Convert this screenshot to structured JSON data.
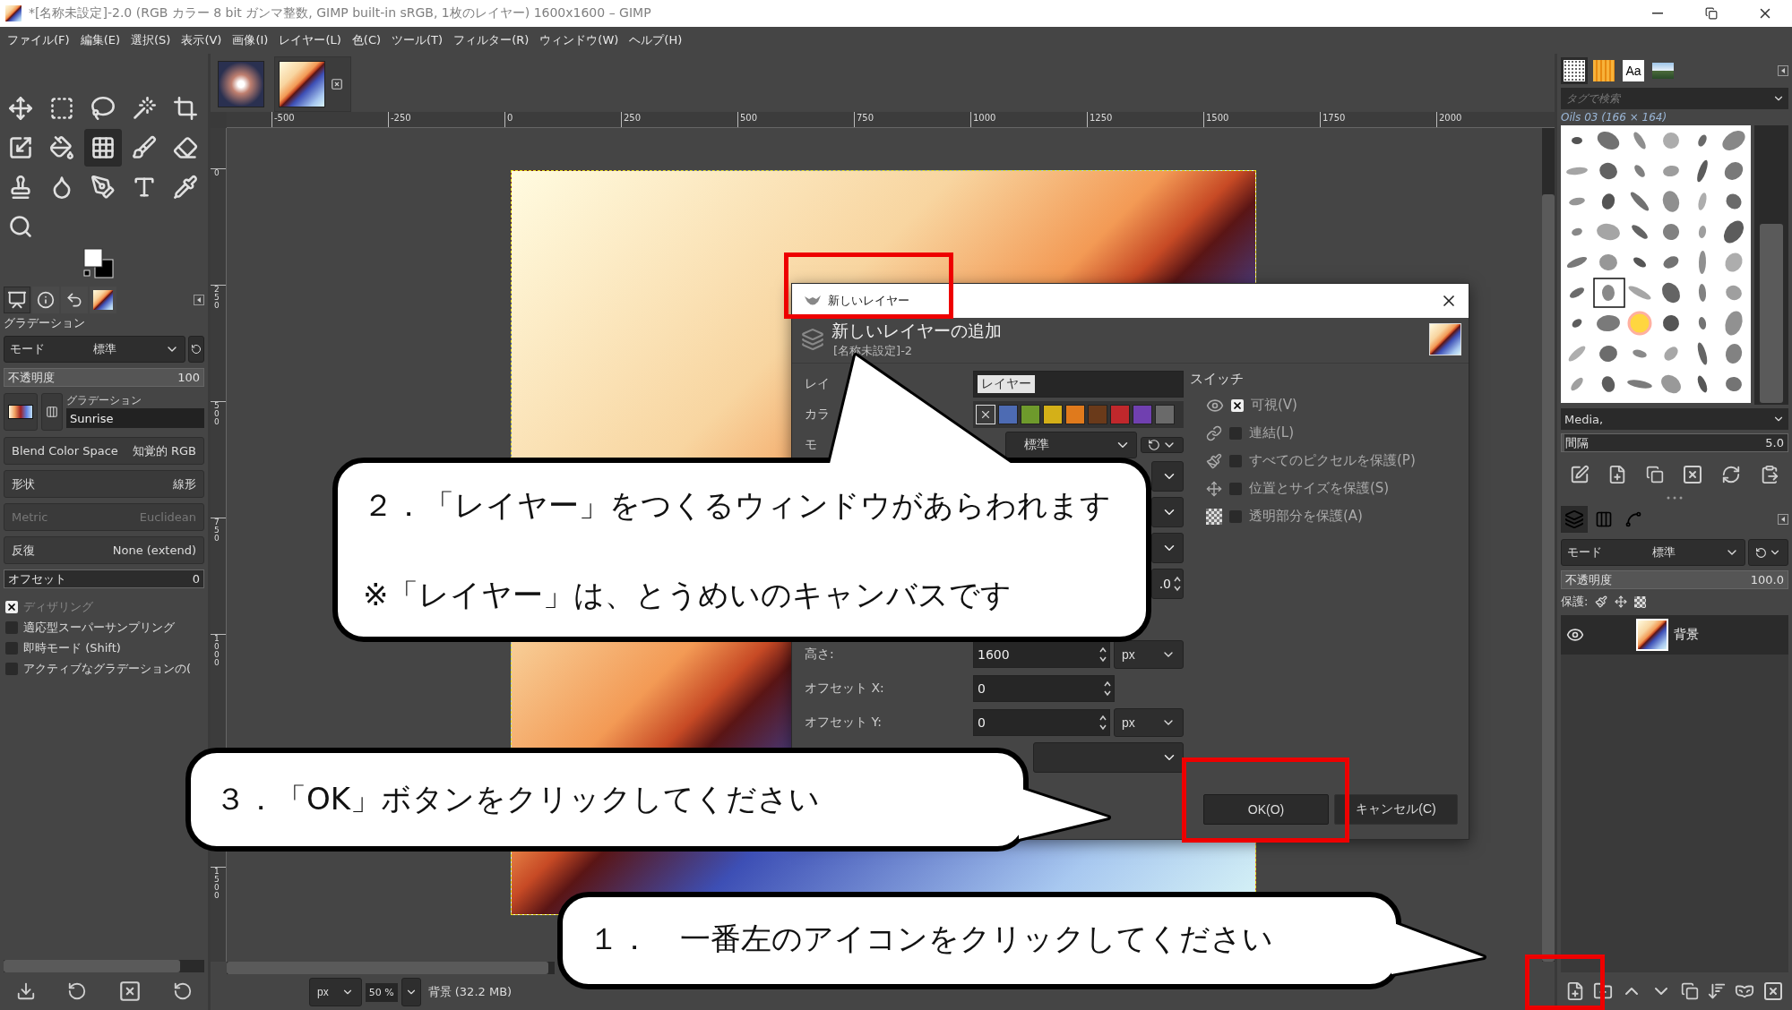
{
  "window": {
    "title": "*[名称未設定]-2.0 (RGB カラー 8 bit ガンマ整数, GIMP built-in sRGB, 1枚のレイヤー) 1600x1600 – GIMP"
  },
  "menu": [
    "ファイル(F)",
    "編集(E)",
    "選択(S)",
    "表示(V)",
    "画像(I)",
    "レイヤー(L)",
    "色(C)",
    "ツール(T)",
    "フィルター(R)",
    "ウィンドウ(W)",
    "ヘルプ(H)"
  ],
  "toolbox": {
    "tools": [
      {
        "selected": false
      },
      {
        "selected": false
      },
      {
        "selected": false
      },
      {
        "selected": false
      },
      {
        "selected": false
      },
      {
        "selected": false
      },
      {
        "selected": false
      },
      {
        "selected": true
      },
      {
        "selected": false
      },
      {
        "selected": false
      },
      {
        "selected": false
      },
      {
        "selected": false
      },
      {
        "selected": false
      },
      {
        "selected": false
      },
      {
        "selected": false
      },
      {
        "selected": false
      }
    ]
  },
  "tool_options": {
    "tabs": [
      {
        "kind": "options",
        "selected": true
      },
      {
        "kind": "info",
        "selected": false
      },
      {
        "kind": "undo",
        "selected": false
      },
      {
        "kind": "gradient",
        "selected": false
      }
    ],
    "title": "グラデーション",
    "mode": {
      "label": "モード",
      "value": "標準"
    },
    "opacity": {
      "label": "不透明度",
      "value": "100",
      "level": 1
    },
    "gradient": {
      "label": "グラデーション",
      "name": "Sunrise"
    },
    "rows": [
      {
        "label": "Blend Color Space",
        "value": "知覚的 RGB",
        "disabled": false
      },
      {
        "label": "形状",
        "value": "線形",
        "disabled": false
      },
      {
        "label": "Metric",
        "value": "Euclidean",
        "disabled": true
      },
      {
        "label": "反復",
        "value": "None (extend)",
        "disabled": false
      }
    ],
    "offset": {
      "label": "オフセット",
      "value": "0"
    },
    "options": [
      {
        "label": "ディザリング",
        "checked": true,
        "disabled": true
      },
      {
        "label": "適応型スーパーサンプリング",
        "checked": false,
        "disabled": false
      },
      {
        "label": "即時モード (Shift)",
        "checked": false,
        "disabled": false
      },
      {
        "label": "アクティブなグラデーションの(",
        "checked": false,
        "disabled": false
      }
    ]
  },
  "image_tabs": [
    {
      "kind": "photo",
      "selected": false
    },
    {
      "kind": "gradient",
      "selected": true
    }
  ],
  "rulers": {
    "horizontal": [
      "-500",
      "-250",
      "0",
      "250",
      "500",
      "750",
      "1000",
      "1250",
      "1500",
      "1750",
      "2000"
    ],
    "vertical": [
      "0",
      "250",
      "500",
      "750",
      "1000",
      "1500"
    ]
  },
  "status_bar": {
    "unit": "px",
    "zoom": "50 %",
    "info": "背景 (32.2 MB)"
  },
  "dialog": {
    "title": "新しいレイヤー",
    "heading": "新しいレイヤーの追加",
    "subtitle": "[名称未設定]-2",
    "rows": [
      {
        "kind": "text",
        "label": "レイ",
        "value": "レイヤー"
      },
      {
        "kind": "colors",
        "label": "カラ",
        "tags": [
          {
            "kind": "none",
            "selected": true
          },
          {
            "kind": "color",
            "color": "#4d6bb3",
            "selected": false
          },
          {
            "kind": "color",
            "color": "#6e9a2c",
            "selected": false
          },
          {
            "kind": "color",
            "color": "#d4b018",
            "selected": false
          },
          {
            "kind": "color",
            "color": "#e07a1c",
            "selected": false
          },
          {
            "kind": "color",
            "color": "#6a3a1a",
            "selected": false
          },
          {
            "kind": "color",
            "color": "#c0282c",
            "selected": false
          },
          {
            "kind": "color",
            "color": "#7040b0",
            "selected": false
          },
          {
            "kind": "color",
            "color": "#6a6a6a",
            "selected": false
          }
        ]
      },
      {
        "kind": "mode",
        "label": "モ",
        "value": "標準"
      },
      {
        "kind": "dropdown_stub"
      },
      {
        "kind": "dropdown_stub"
      },
      {
        "kind": "dropdown_stub"
      },
      {
        "kind": "spin_wide",
        "value": ".0"
      },
      {
        "kind": "blank"
      },
      {
        "kind": "spin",
        "label": "高さ:",
        "value": "1600",
        "unit": "px"
      },
      {
        "kind": "spin",
        "label": "オフセット X:",
        "value": "0"
      },
      {
        "kind": "spin",
        "label": "オフセット Y:",
        "value": "0",
        "unit": "px"
      },
      {
        "kind": "dropdown"
      }
    ],
    "switches_title": "スイッチ",
    "switches": [
      {
        "kind": "eye",
        "label": "可視(V)",
        "checked": true
      },
      {
        "kind": "chain",
        "label": "連結(L)",
        "checked": false
      },
      {
        "kind": "brush",
        "label": "すべてのピクセルを保護(P)",
        "checked": false
      },
      {
        "kind": "move",
        "label": "位置とサイズを保護(S)",
        "checked": false
      },
      {
        "kind": "checker",
        "label": "透明部分を保護(A)",
        "checked": false
      }
    ],
    "buttons": [
      {
        "label": "OK(O)",
        "kind": "default"
      },
      {
        "label": "キャンセル(C)",
        "kind": "normal"
      }
    ]
  },
  "brushes": {
    "tabs": [
      {
        "kind": "brush",
        "selected": true
      },
      {
        "kind": "pattern",
        "selected": false
      },
      {
        "kind": "font",
        "label": "Aa",
        "selected": false
      },
      {
        "kind": "gradient",
        "selected": false
      }
    ],
    "search_placeholder": "タグで検索",
    "current": "Oils 03 (166 × 164)",
    "tag": "Media,",
    "spacing": {
      "label": "間隔",
      "value": "5.0",
      "level": 0.01
    }
  },
  "layers": {
    "tabs": [
      {
        "kind": "layers",
        "selected": true
      },
      {
        "kind": "channels",
        "selected": false
      },
      {
        "kind": "paths",
        "selected": false
      }
    ],
    "mode": {
      "label": "モード",
      "value": "標準"
    },
    "opacity": {
      "label": "不透明度",
      "value": "100.0",
      "level": 1
    },
    "lock_label": "保護:",
    "items": [
      {
        "name": "背景",
        "visible": true,
        "selected": true
      }
    ]
  },
  "callouts": [
    {
      "lines": [
        "１．　一番左のアイコンをクリックしてください"
      ]
    },
    {
      "lines": [
        "２．「レイヤー」をつくるウィンドウがあらわれます",
        "※「レイヤー」は、とうめいのキャンバスです"
      ]
    },
    {
      "lines": [
        "３．「OK」ボタンをクリックしてください"
      ]
    }
  ]
}
